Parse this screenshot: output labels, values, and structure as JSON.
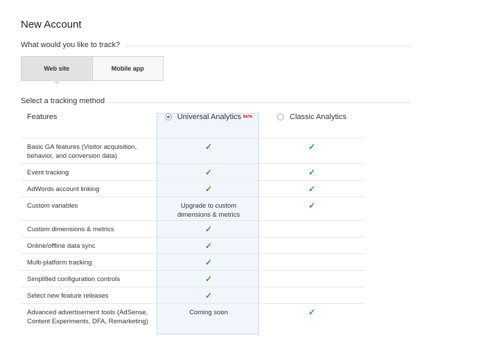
{
  "title": "New Account",
  "track": {
    "question": "What would you like to track?",
    "options": [
      {
        "label": "Web site",
        "active": true
      },
      {
        "label": "Mobile app",
        "active": false
      }
    ]
  },
  "method": {
    "label": "Select a tracking method",
    "features_header": "Features",
    "universal": {
      "label": "Universal Analytics",
      "badge": "BETA",
      "selected": true
    },
    "classic": {
      "label": "Classic Analytics",
      "selected": false
    }
  },
  "rows": [
    {
      "feature": "Basic GA features (Visitor acquisition, behavior, and conversion data)",
      "ua": "check",
      "classic": "check"
    },
    {
      "feature": "Event tracking",
      "ua": "check",
      "classic": "check"
    },
    {
      "feature": "AdWords account linking",
      "ua": "check",
      "classic": "check"
    },
    {
      "feature": "Custom variables",
      "ua": "Upgrade to custom dimensions & metrics",
      "classic": "check"
    },
    {
      "feature": "Custom dimensions & metrics",
      "ua": "check",
      "classic": ""
    },
    {
      "feature": "Online/offline data sync",
      "ua": "check",
      "classic": ""
    },
    {
      "feature": "Multi-platform tracking",
      "ua": "check",
      "classic": ""
    },
    {
      "feature": "Simplified configuration controls",
      "ua": "check",
      "classic": ""
    },
    {
      "feature": "Select new feature releases",
      "ua": "check",
      "classic": ""
    },
    {
      "feature": "Advanced advertisement tools (AdSense, Content Experiments, DFA, Remarketing)",
      "ua": "Coming soon",
      "classic": "check"
    }
  ],
  "check_glyph": "✓",
  "colors": {
    "check": "#2a9d2a",
    "ua_column": "#f1f6fc",
    "beta": "#cc0000"
  }
}
